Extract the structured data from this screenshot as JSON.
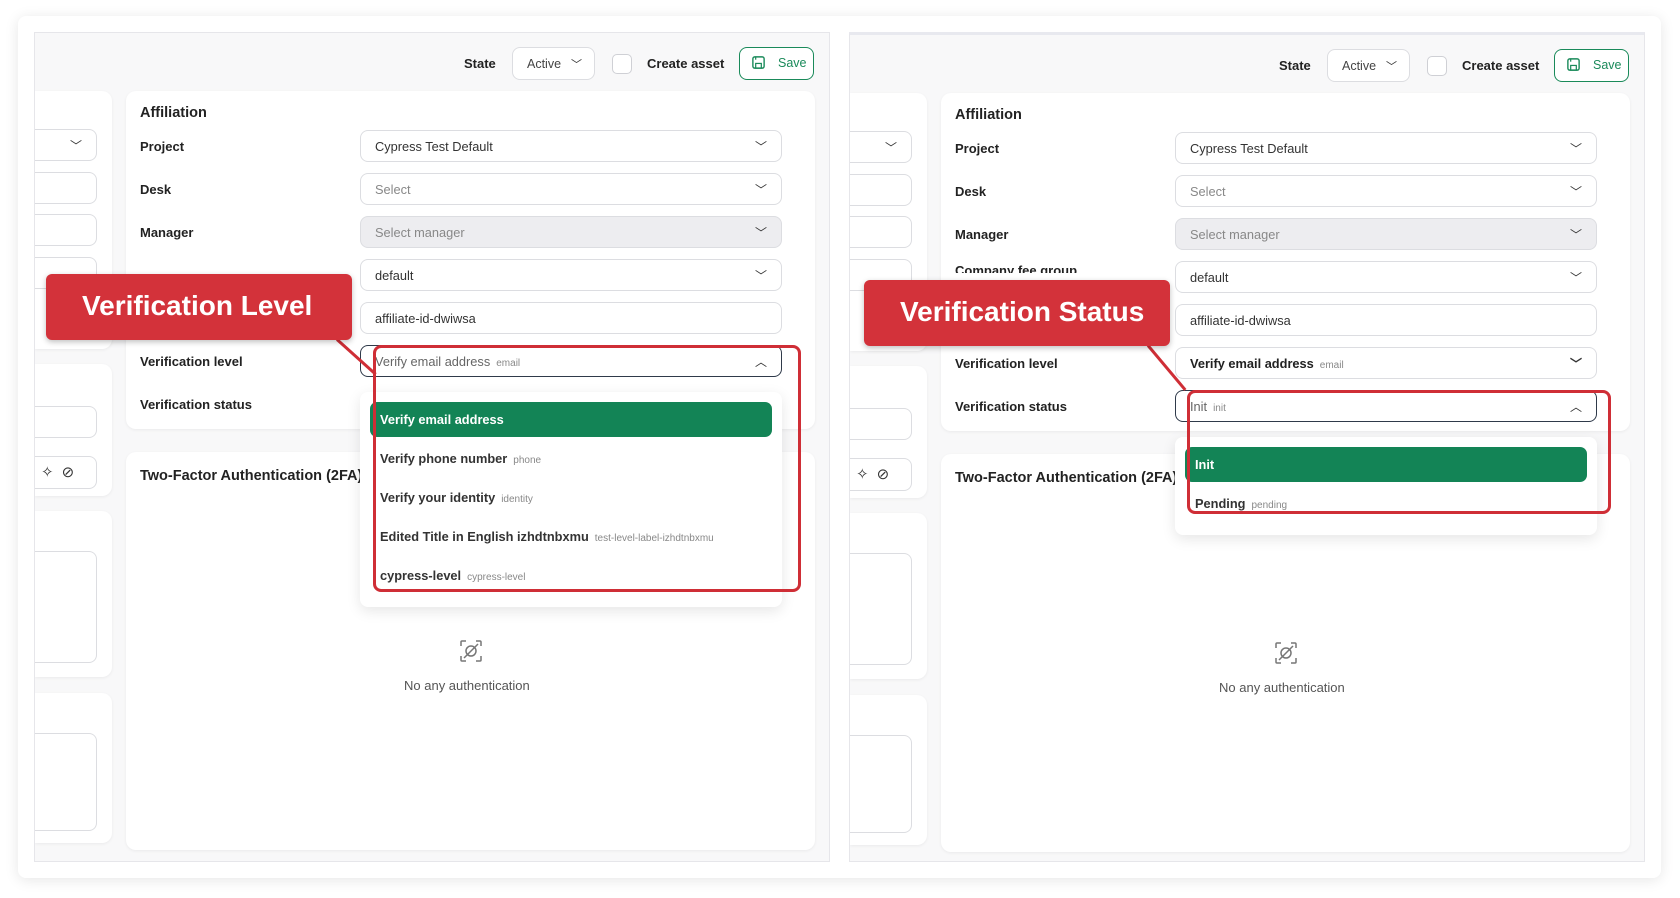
{
  "colors": {
    "accent": "#138456",
    "annotation": "#cf2e36"
  },
  "left": {
    "topbar": {
      "state_label": "State",
      "state_value": "Active",
      "create_asset_label": "Create asset",
      "save_label": "Save"
    },
    "affiliation": {
      "title": "Affiliation",
      "project": {
        "label": "Project",
        "value": "Cypress Test Default"
      },
      "desk": {
        "label": "Desk",
        "placeholder": "Select"
      },
      "manager": {
        "label": "Manager",
        "placeholder": "Select manager"
      },
      "fee_group": {
        "value": "default"
      },
      "affiliate_id": {
        "value": "affiliate-id-dwiwsa"
      },
      "verification_level": {
        "label": "Verification level",
        "value": "Verify email address",
        "tag": "email"
      },
      "verification_status": {
        "label": "Verification status"
      }
    },
    "level_options": [
      {
        "label": "Verify email address",
        "tag": ""
      },
      {
        "label": "Verify phone number",
        "tag": "phone"
      },
      {
        "label": "Verify your identity",
        "tag": "identity"
      },
      {
        "label": "Edited Title in English izhdtnbxmu",
        "tag": "test-level-label-izhdtnbxmu"
      },
      {
        "label": "cypress-level",
        "tag": "cypress-level"
      }
    ],
    "twofa": {
      "title": "Two-Factor Authentication (2FA)",
      "empty_text": "No any authentication"
    },
    "callout": "Verification Level"
  },
  "right": {
    "topbar": {
      "state_label": "State",
      "state_value": "Active",
      "create_asset_label": "Create asset",
      "save_label": "Save"
    },
    "affiliation": {
      "title": "Affiliation",
      "project": {
        "label": "Project",
        "value": "Cypress Test Default"
      },
      "desk": {
        "label": "Desk",
        "placeholder": "Select"
      },
      "manager": {
        "label": "Manager",
        "placeholder": "Select manager"
      },
      "fee_group": {
        "label": "Company fee group",
        "value": "default"
      },
      "affiliate_id": {
        "value": "affiliate-id-dwiwsa"
      },
      "verification_level": {
        "label": "Verification level",
        "value": "Verify email address",
        "tag": "email"
      },
      "verification_status": {
        "label": "Verification status",
        "value": "Init",
        "tag": "init"
      }
    },
    "status_options": [
      {
        "label": "Init",
        "tag": ""
      },
      {
        "label": "Pending",
        "tag": "pending"
      }
    ],
    "twofa": {
      "title": "Two-Factor Authentication (2FA)",
      "empty_text": "No any authentication"
    },
    "callout": "Verification Status"
  }
}
